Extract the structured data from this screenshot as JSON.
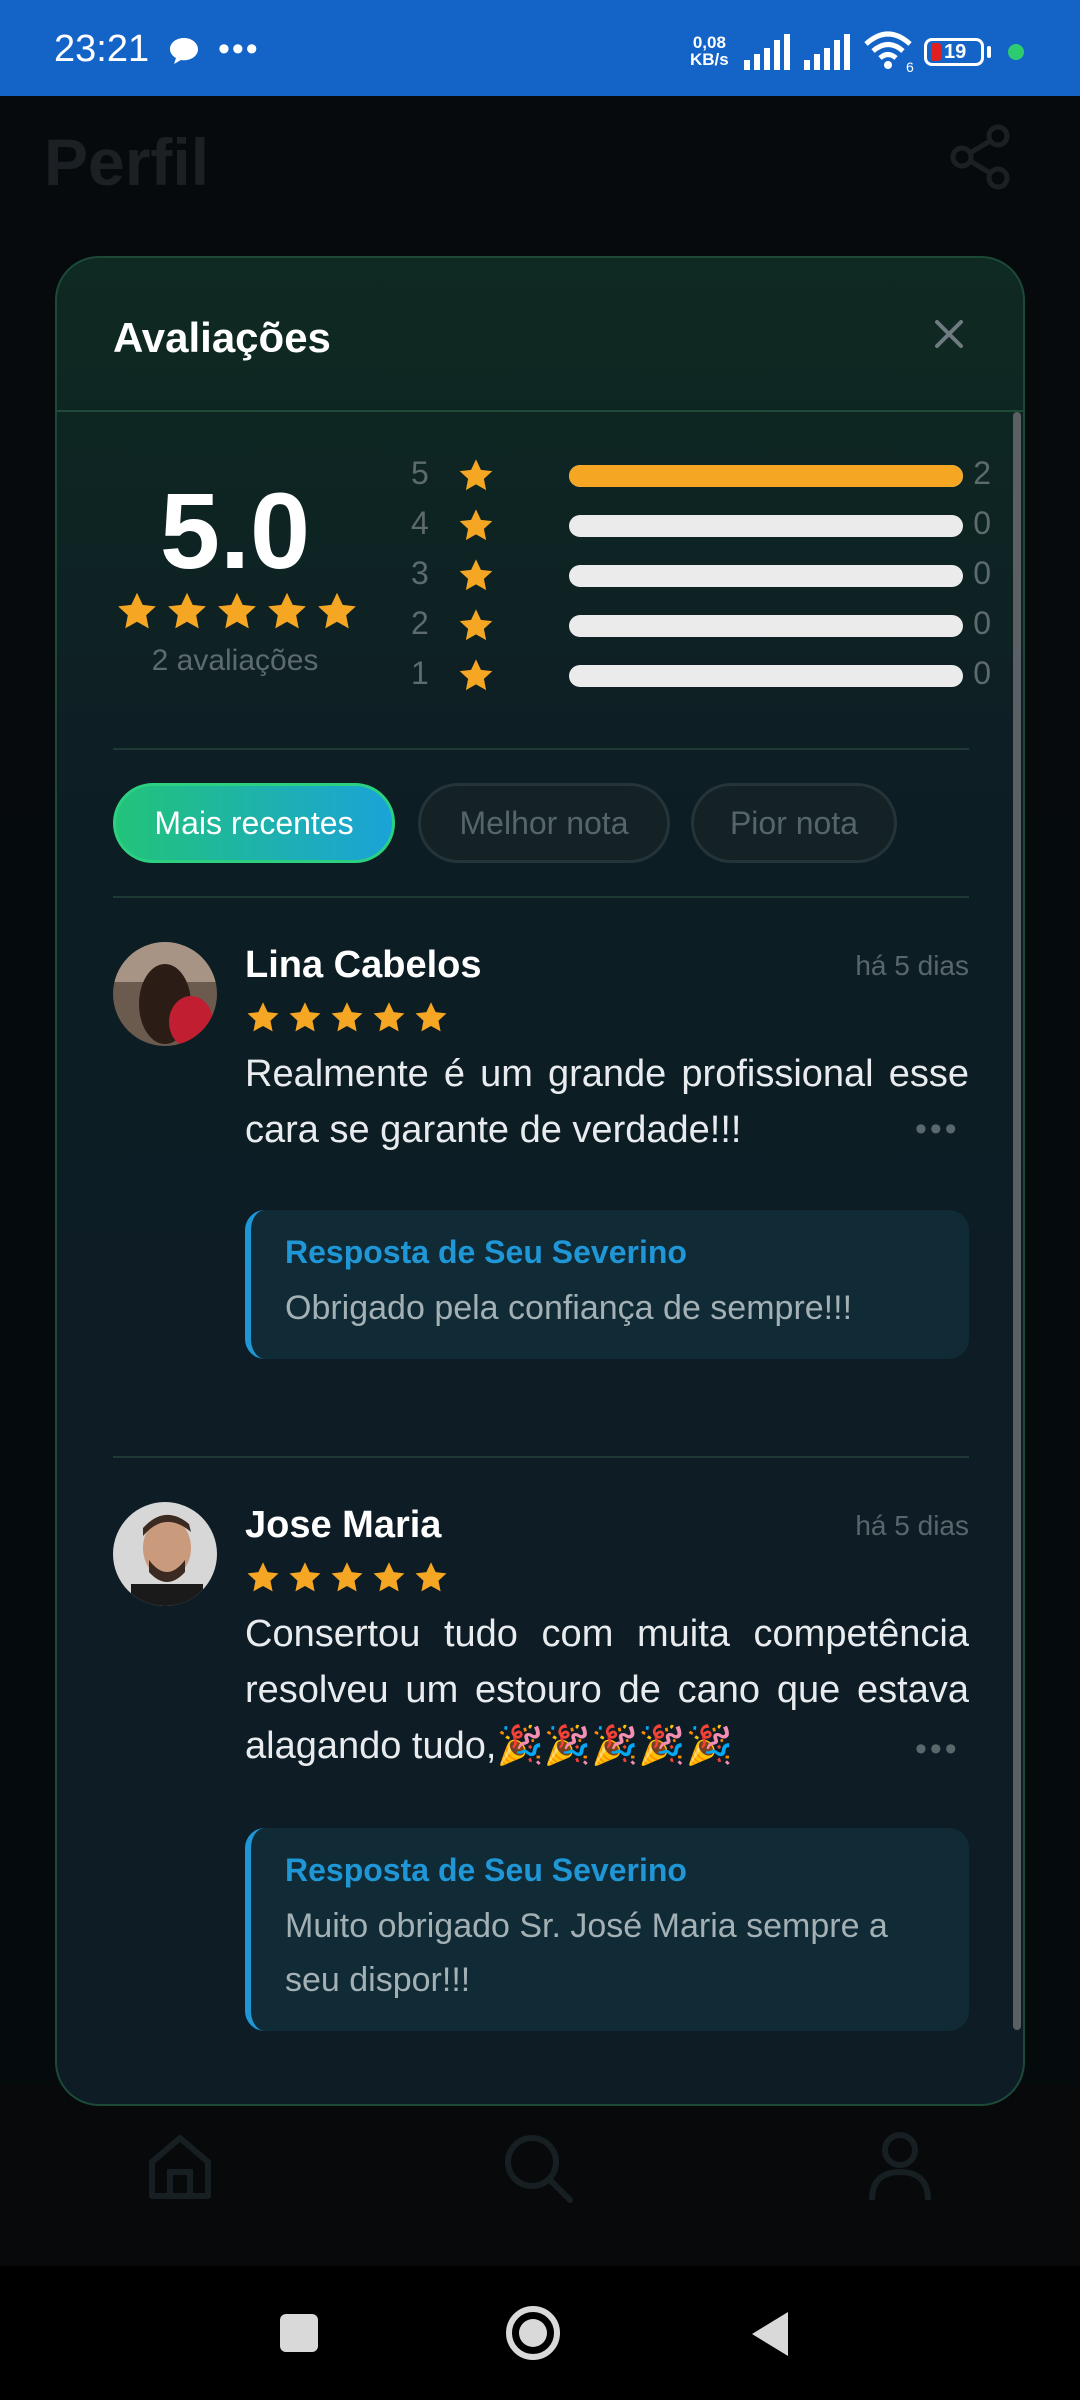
{
  "status_bar": {
    "time": "23:21",
    "more": "•••",
    "speed_value": "0,08",
    "speed_unit": "KB/s",
    "wifi_badge": "6",
    "battery": "19",
    "colors": {
      "bar": "#1464c8",
      "battery_low": "#e02020",
      "dot": "#2ecc71"
    }
  },
  "page": {
    "title": "Perfil",
    "share_icon": "share-icon"
  },
  "modal": {
    "title": "Avaliações",
    "close_icon": "close-icon",
    "summary": {
      "average": "5.0",
      "stars": 5,
      "count_label": "2 avaliações"
    },
    "distribution": [
      {
        "stars": "5",
        "count": "2",
        "fraction": 1.0
      },
      {
        "stars": "4",
        "count": "0",
        "fraction": 0
      },
      {
        "stars": "3",
        "count": "0",
        "fraction": 0
      },
      {
        "stars": "2",
        "count": "0",
        "fraction": 0
      },
      {
        "stars": "1",
        "count": "0",
        "fraction": 0
      }
    ],
    "filters": [
      {
        "label": "Mais recentes",
        "active": true
      },
      {
        "label": "Melhor nota",
        "active": false
      },
      {
        "label": "Pior nota",
        "active": false
      }
    ],
    "reviews": [
      {
        "name": "Lina Cabelos",
        "date": "há 5 dias",
        "rating": 5,
        "text": "Realmente é um grande profissional esse cara se garante de verdade!!!",
        "more": "•••",
        "reply_title": "Resposta de Seu Severino",
        "reply_text": "Obrigado pela confiança de sempre!!!"
      },
      {
        "name": "Jose Maria",
        "date": "há 5 dias",
        "rating": 5,
        "text": "Consertou tudo com muita competência resolveu um estouro de cano que estava alagando tudo,🎉🎉🎉🎉🎉",
        "more": "•••",
        "reply_title": "Resposta de Seu Severino",
        "reply_text": "Muito obrigado Sr. José Maria sempre a seu dispor!!!"
      }
    ],
    "colors": {
      "star": "#f5a623",
      "accent_green": "#22c37a",
      "accent_blue": "#1f96d6"
    }
  },
  "bottom_nav": {
    "items": [
      "home-icon",
      "search-icon",
      "profile-icon"
    ]
  }
}
